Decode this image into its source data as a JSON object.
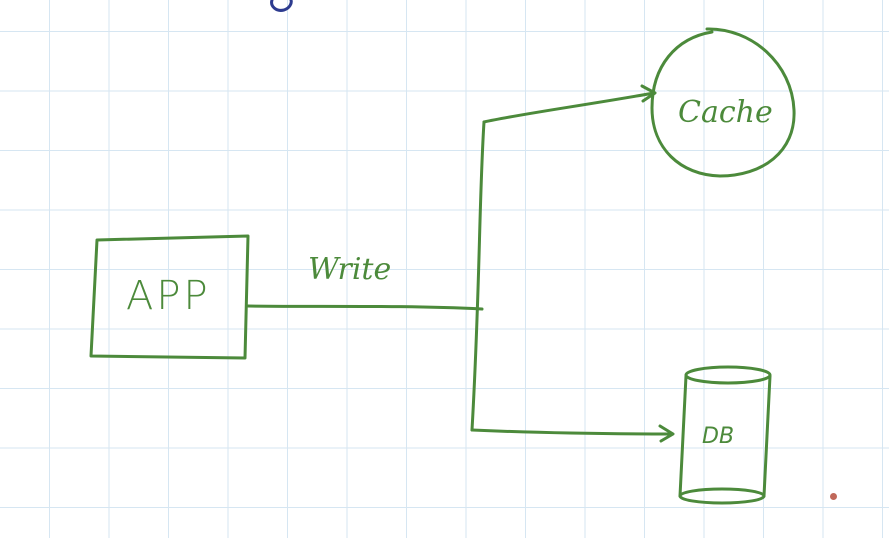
{
  "diagram": {
    "nodes": {
      "app": {
        "label": "APP",
        "shape": "rectangle"
      },
      "cache": {
        "label": "Cache",
        "shape": "circle"
      },
      "db": {
        "label": "DB",
        "shape": "cylinder"
      }
    },
    "edges": [
      {
        "from": "app",
        "to": "cache",
        "label": "Write"
      },
      {
        "from": "app",
        "to": "db",
        "label": ""
      }
    ]
  },
  "colors": {
    "ink": "#4c8a3b",
    "grid": "#d6e6f2",
    "background": "#ffffff",
    "title_ink": "#2d3b8f",
    "pointer": "#c0685a"
  }
}
